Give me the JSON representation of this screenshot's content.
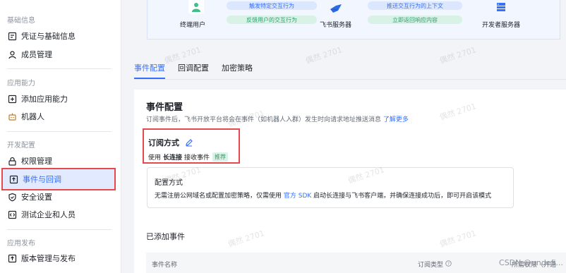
{
  "sidebar": {
    "sections": [
      {
        "title": "基础信息",
        "items": [
          {
            "label": "凭证与基础信息",
            "icon": "credential-icon"
          },
          {
            "label": "成员管理",
            "icon": "user-icon"
          }
        ]
      },
      {
        "title": "应用能力",
        "items": [
          {
            "label": "添加应用能力",
            "icon": "add-icon"
          },
          {
            "label": "机器人",
            "icon": "robot-icon"
          }
        ]
      },
      {
        "title": "开发配置",
        "items": [
          {
            "label": "权限管理",
            "icon": "lock-icon"
          },
          {
            "label": "事件与回调",
            "icon": "event-icon",
            "active": true
          },
          {
            "label": "安全设置",
            "icon": "shield-icon"
          },
          {
            "label": "测试企业和人员",
            "icon": "code-icon"
          }
        ]
      },
      {
        "title": "应用发布",
        "items": [
          {
            "label": "版本管理与发布",
            "icon": "upload-icon"
          }
        ]
      }
    ]
  },
  "diagram": {
    "user": "终端用户",
    "feishu": "飞书服务器",
    "dev": "开发者服务器",
    "arrow1": "触发特定交互行为",
    "arrow2": "反馈用户的交互行为",
    "arrow3": "推送交互行为的上下文",
    "arrow4": "立即返回响应内容"
  },
  "tabs": [
    "事件配置",
    "回调配置",
    "加密策略"
  ],
  "card": {
    "title": "事件配置",
    "desc": "订阅事件后，飞书开放平台将会在事件（如机器人入群）发生时向请求地址推送消息",
    "learn_more": "了解更多",
    "sub_title": "订阅方式",
    "sub_use": "使用",
    "sub_mode": "长连接",
    "sub_recv": "接收事件",
    "sub_badge": "推荐",
    "config_title": "配置方式",
    "config_desc_1": "无需注册公网域名或配置加密策略，仅需使用",
    "config_link": "官方 SDK",
    "config_desc_2": "启动长连接与飞书客户端，并确保连接成功后，即可开启该模式",
    "added_title": "已添加事件",
    "col_name": "事件名称",
    "col_type": "订阅类型",
    "col_perm": "所需权限（开通"
  },
  "watermark": "偶然 2701",
  "csdn": "CSDN @undefi..."
}
